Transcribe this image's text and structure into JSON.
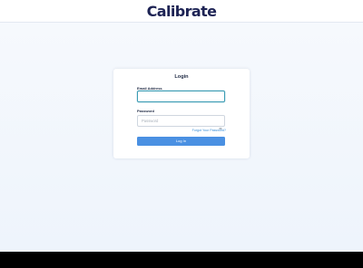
{
  "header": {
    "logo_text": "Calibrate"
  },
  "login": {
    "title": "Login",
    "email_label": "Email Address",
    "email_value": "",
    "password_label": "Password",
    "password_placeholder": "Password",
    "password_toggle_icon": "eye-icon",
    "forgot_password": "Forgot Your Password?",
    "submit_label": "Log In"
  },
  "colors": {
    "brand": "#1d2354",
    "accent": "#4a90e2",
    "focus_border": "#3a9bb3",
    "page_background": "#f2f7fd",
    "footer": "#000000"
  }
}
